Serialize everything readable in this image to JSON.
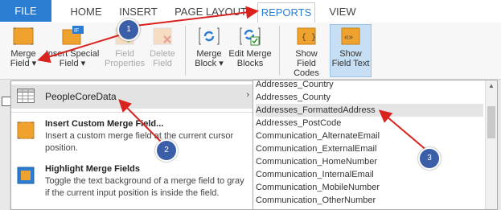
{
  "tabs": [
    {
      "label": "FILE"
    },
    {
      "label": "HOME"
    },
    {
      "label": "INSERT"
    },
    {
      "label": "PAGE LAYOUT"
    },
    {
      "label": "REPORTS"
    },
    {
      "label": "VIEW"
    }
  ],
  "active_tab": "REPORTS",
  "ribbon": {
    "merge_field": {
      "line1": "Merge",
      "line2": "Field ▾"
    },
    "insert_special_field": {
      "line1": "Insert Special",
      "line2": "Field ▾",
      "badge": "IF"
    },
    "field_properties": {
      "line1": "Field",
      "line2": "Properties"
    },
    "delete_field": {
      "line1": "Delete",
      "line2": "Field"
    },
    "merge_block": {
      "line1": "Merge",
      "line2": "Block ▾"
    },
    "edit_merge_blocks": {
      "line1": "Edit Merge",
      "line2": "Blocks"
    },
    "show_field_codes": {
      "line1": "Show Field",
      "line2": "Codes",
      "icon_text": "{ }"
    },
    "show_field_text": {
      "line1": "Show",
      "line2": "Field Text",
      "icon_text": "«»"
    }
  },
  "menu": {
    "people": {
      "label": "PeopleCoreData",
      "arrow": "›"
    },
    "insert_custom": {
      "title": "Insert Custom Merge Field...",
      "desc": "Insert a custom merge field at the current cursor position."
    },
    "highlight": {
      "title": "Highlight Merge Fields",
      "desc": "Toggle the text background of a merge field to gray if the current input position is inside the field."
    }
  },
  "fields": [
    "Addresses_Country",
    "Addresses_County",
    "Addresses_FormattedAddress",
    "Addresses_PostCode",
    "Communication_AlternateEmail",
    "Communication_ExternalEmail",
    "Communication_HomeNumber",
    "Communication_InternalEmail",
    "Communication_MobileNumber",
    "Communication_OtherNumber"
  ],
  "selected_field": "Addresses_FormattedAddress",
  "annotations": [
    "1",
    "2",
    "3"
  ],
  "colors": {
    "accent": "#2b7cd3",
    "annotation": "#3b5ea8",
    "arrow": "#d9231f",
    "merge_icon": "#f0a22e"
  }
}
